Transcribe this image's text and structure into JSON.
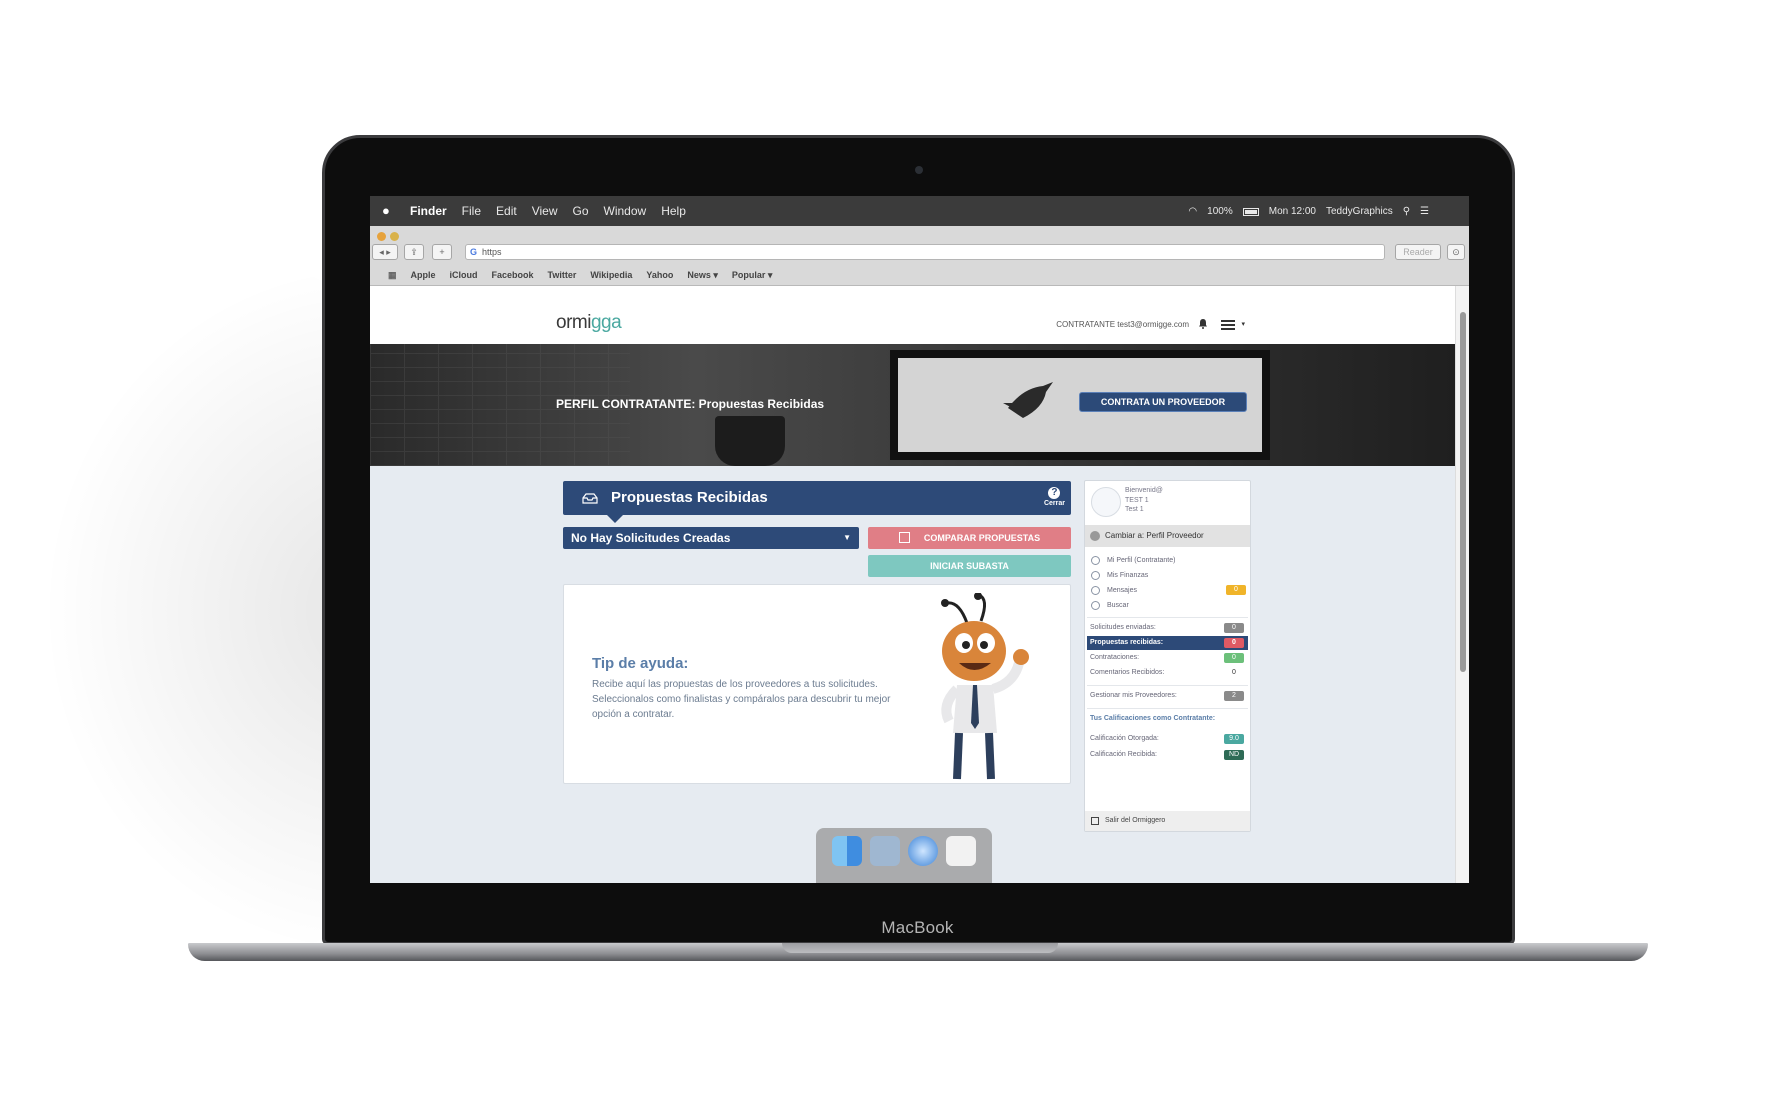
{
  "device": {
    "label": "MacBook"
  },
  "menubar": {
    "app": "Finder",
    "items": [
      "File",
      "Edit",
      "View",
      "Go",
      "Window",
      "Help"
    ],
    "battery": "100%",
    "clock": "Mon 12:00",
    "user": "TeddyGraphics"
  },
  "browser": {
    "url": "https",
    "reader": "Reader",
    "bookmarks": [
      "Apple",
      "iCloud",
      "Facebook",
      "Twitter",
      "Wikipedia",
      "Yahoo",
      "News ▾",
      "Popular ▾"
    ]
  },
  "site": {
    "logo": {
      "part1": "ormi",
      "part2": "gga"
    },
    "user_role": "CONTRATANTE",
    "user_email": "test3@ormigge.com",
    "banner_title": "PERFIL CONTRATANTE: Propuestas Recibidas",
    "banner_button": "CONTRATA UN PROVEEDOR",
    "panel": {
      "title": "Propuestas Recibidas",
      "help_label": "Cerrar",
      "select_value": "No Hay Solicitudes Creadas",
      "compare_button": "COMPARAR PROPUESTAS",
      "auction_button": "INICIAR SUBASTA",
      "tip_title": "Tip de ayuda:",
      "tip_body": "Recibe aquí las propuestas de los proveedores a tus solicitudes. Seleccionalos como finalistas y compáralos para descubrir tu mejor opción a contratar."
    },
    "sidebar": {
      "welcome": "Bienvenid@",
      "name1": "TEST 1",
      "name2": "Test 1",
      "switch": "Cambiar a: Perfil Proveedor",
      "menu": [
        "Mi Perfil (Contratante)",
        "Mis Finanzas",
        "Mensajes",
        "Buscar"
      ],
      "messages_count": "0",
      "stats": [
        {
          "label": "Solicitudes enviadas:",
          "value": "0",
          "color": "#8a8a8a"
        },
        {
          "label": "Propuestas recibidas:",
          "value": "0",
          "color": "#e05a64"
        },
        {
          "label": "Contrataciones:",
          "value": "0",
          "color": "#6cc07a"
        },
        {
          "label": "Comentarios Recibidos:",
          "value": "0",
          "color": "#ffffff"
        }
      ],
      "providers": {
        "label": "Gestionar mis Proveedores:",
        "value": "2"
      },
      "ratings_title": "Tus Calificaciones como Contratante:",
      "ratings": [
        {
          "label": "Calificación Otorgada:",
          "value": "9.0",
          "color": "#4aa8a0"
        },
        {
          "label": "Calificación Recibida:",
          "value": "ND",
          "color": "#2e6b56"
        }
      ],
      "exit": "Salir del Ormiggero"
    }
  },
  "colors": {
    "primary": "#2d4a78",
    "compare": "#e07e86",
    "auction": "#7ec8c0",
    "page_bg": "#e6ebf1"
  }
}
